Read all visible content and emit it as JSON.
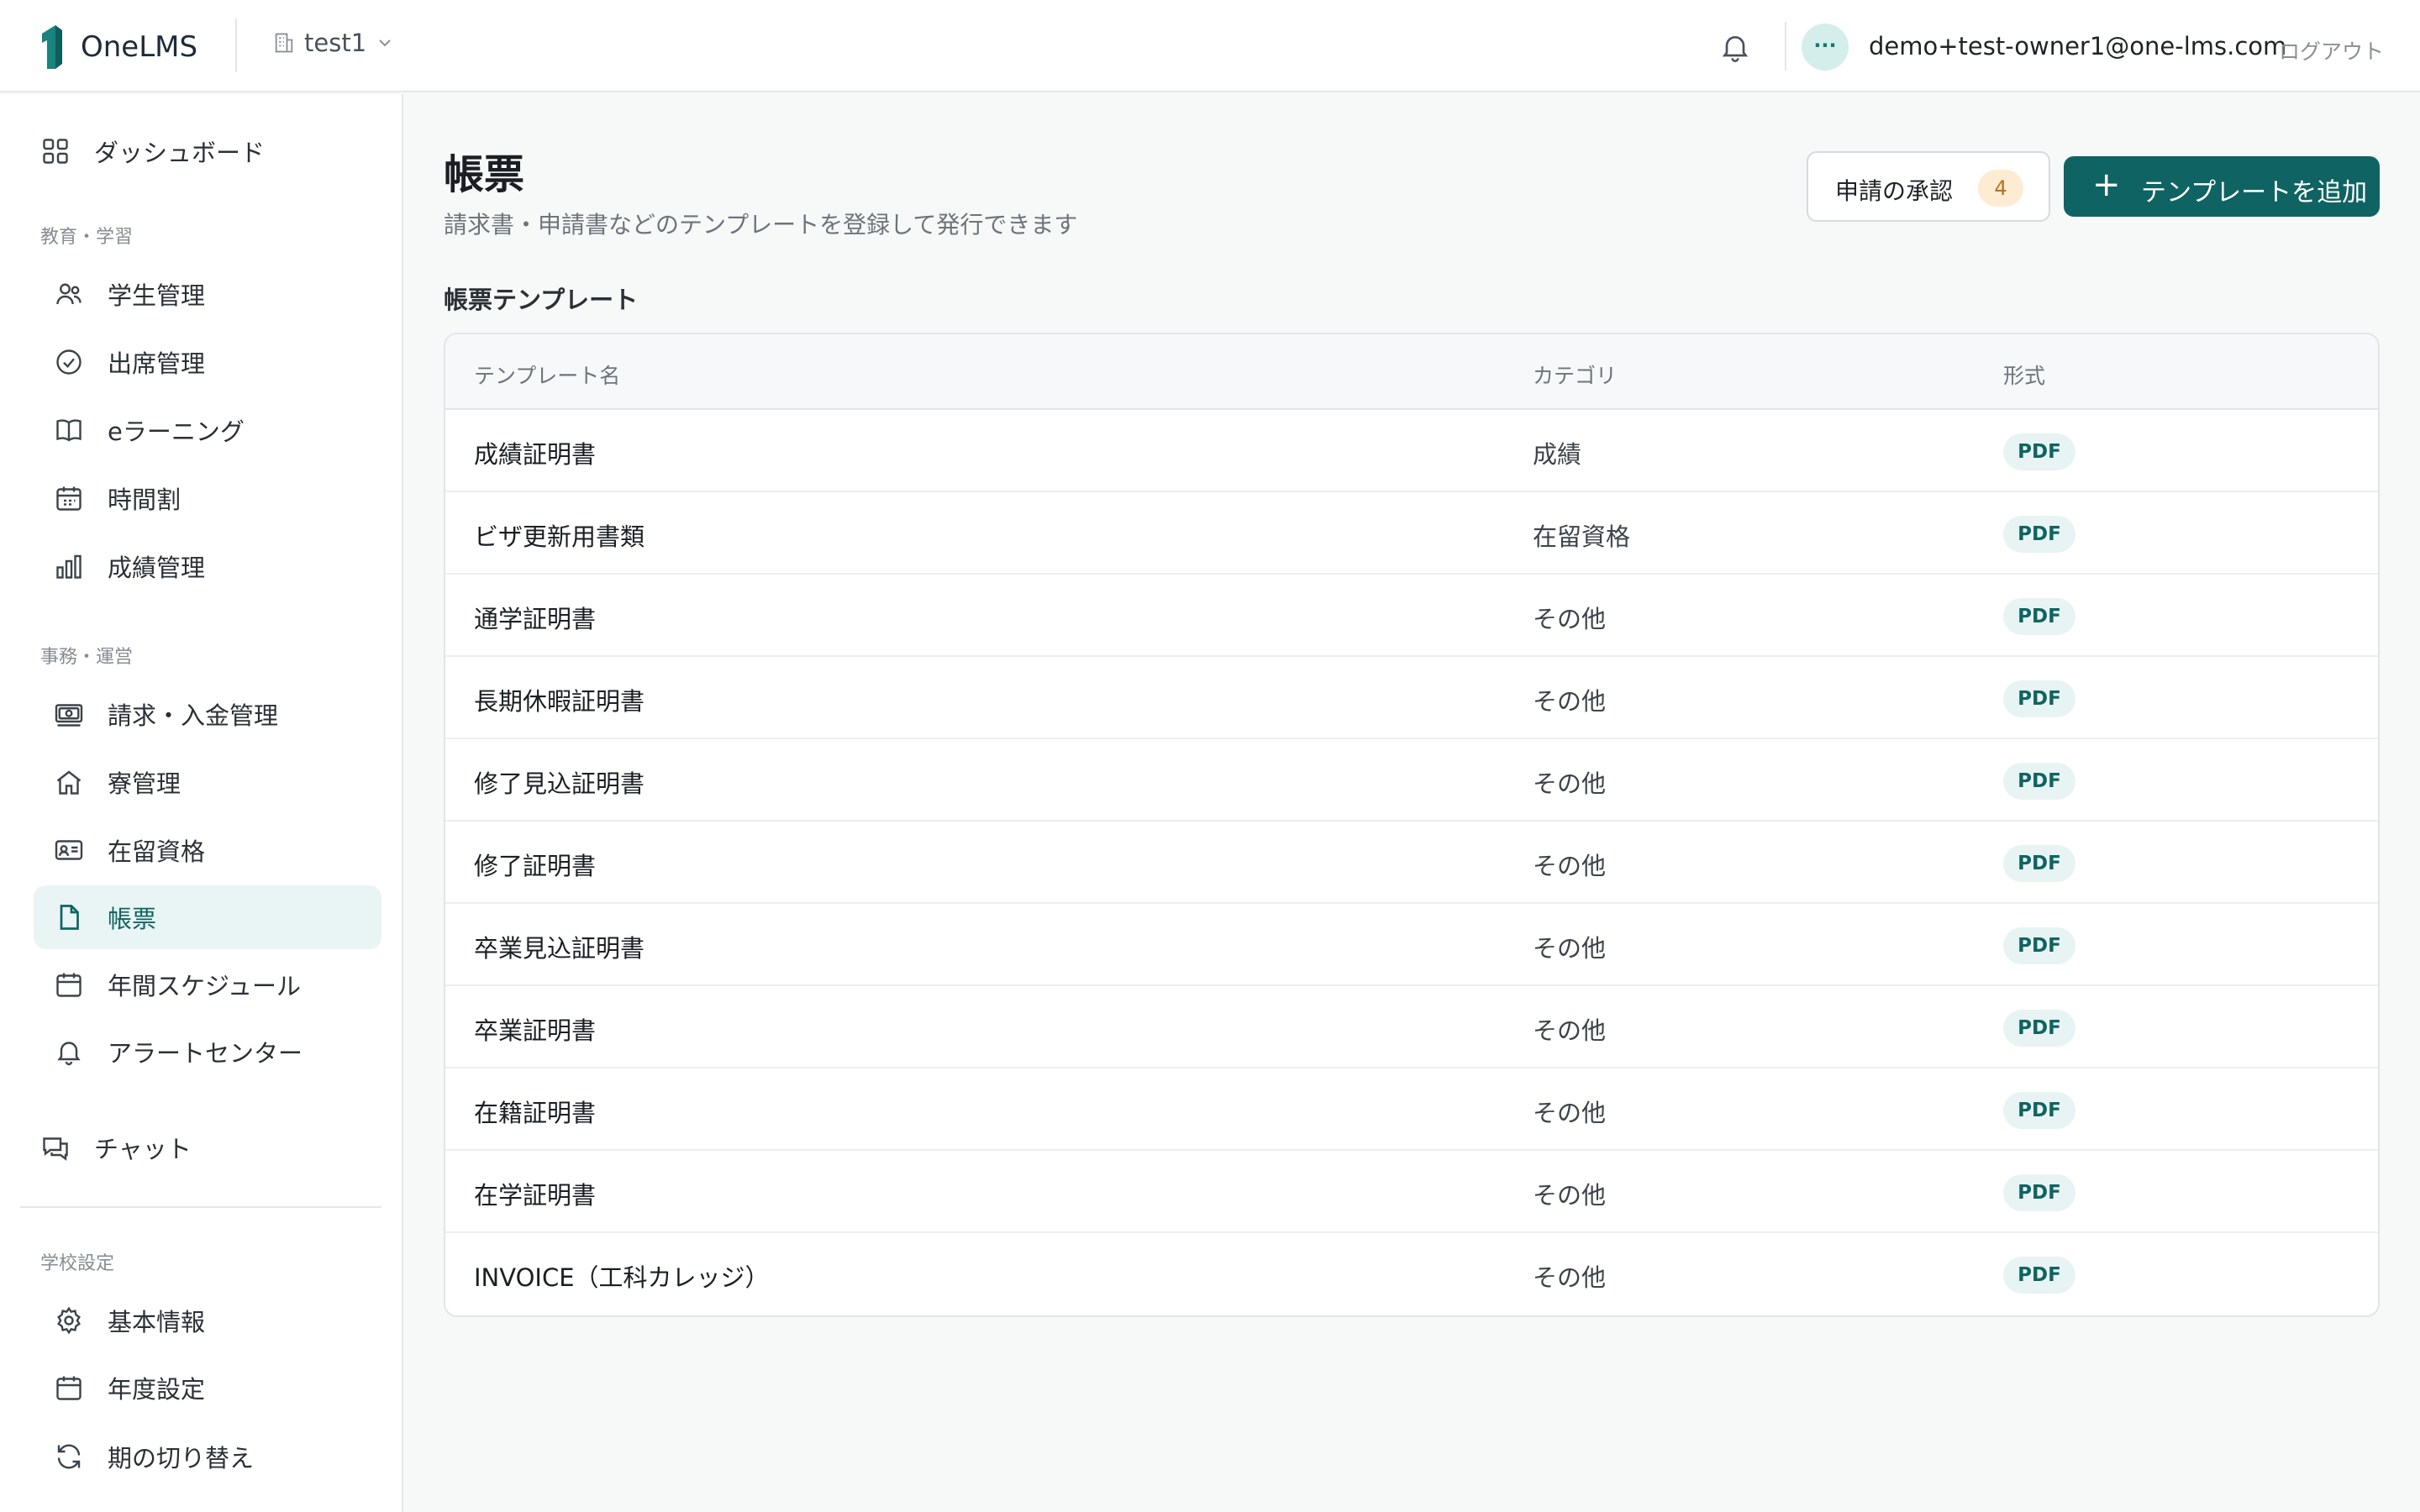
{
  "header": {
    "brand": "OneLMS",
    "school": "test1",
    "avatar_text": "···",
    "user_email": "demo+test-owner1@one-lms.com",
    "logout_label": "ログアウト"
  },
  "sidebar": {
    "dashboard": "ダッシュボード",
    "sections": [
      {
        "label": "教育・学習",
        "items": [
          {
            "label": "学生管理",
            "icon": "users-icon"
          },
          {
            "label": "出席管理",
            "icon": "check-circle-icon"
          },
          {
            "label": "eラーニング",
            "icon": "book-icon"
          },
          {
            "label": "時間割",
            "icon": "calendar-grid-icon"
          },
          {
            "label": "成績管理",
            "icon": "bar-chart-icon"
          }
        ]
      },
      {
        "label": "事務・運営",
        "items": [
          {
            "label": "請求・入金管理",
            "icon": "banknote-icon"
          },
          {
            "label": "寮管理",
            "icon": "home-icon"
          },
          {
            "label": "在留資格",
            "icon": "id-card-icon"
          },
          {
            "label": "帳票",
            "icon": "document-icon",
            "active": true
          },
          {
            "label": "年間スケジュール",
            "icon": "calendar-icon"
          },
          {
            "label": "アラートセンター",
            "icon": "bell-icon"
          }
        ]
      }
    ],
    "chat": "チャット",
    "settings_label": "学校設定",
    "settings_items": [
      {
        "label": "基本情報",
        "icon": "gear-icon"
      },
      {
        "label": "年度設定",
        "icon": "calendar-icon"
      },
      {
        "label": "期の切り替え",
        "icon": "refresh-icon"
      }
    ]
  },
  "main": {
    "title": "帳票",
    "subtitle": "請求書・申請書などのテンプレートを登録して発行できます",
    "approve_label": "申請の承認",
    "approve_count": "4",
    "add_label": "テンプレートを追加",
    "section_title": "帳票テンプレート",
    "columns": [
      "テンプレート名",
      "カテゴリ",
      "形式"
    ],
    "rows": [
      {
        "name": "成績証明書",
        "category": "成績",
        "format": "PDF"
      },
      {
        "name": "ビザ更新用書類",
        "category": "在留資格",
        "format": "PDF"
      },
      {
        "name": "通学証明書",
        "category": "その他",
        "format": "PDF"
      },
      {
        "name": "長期休暇証明書",
        "category": "その他",
        "format": "PDF"
      },
      {
        "name": "修了見込証明書",
        "category": "その他",
        "format": "PDF"
      },
      {
        "name": "修了証明書",
        "category": "その他",
        "format": "PDF"
      },
      {
        "name": "卒業見込証明書",
        "category": "その他",
        "format": "PDF"
      },
      {
        "name": "卒業証明書",
        "category": "その他",
        "format": "PDF"
      },
      {
        "name": "在籍証明書",
        "category": "その他",
        "format": "PDF"
      },
      {
        "name": "在学証明書",
        "category": "その他",
        "format": "PDF"
      },
      {
        "name": "INVOICE（工科カレッジ）",
        "category": "その他",
        "format": "PDF"
      }
    ]
  },
  "colors": {
    "accent": "#0f6463",
    "accent_soft": "#e9f5f4",
    "badge_bg": "#fdecd2",
    "badge_text": "#b5731e"
  }
}
